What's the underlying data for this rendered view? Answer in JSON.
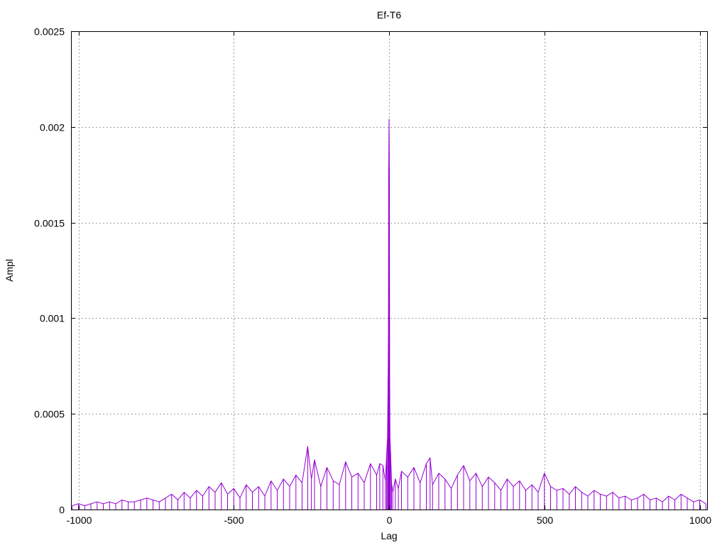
{
  "chart_data": {
    "type": "line",
    "title": "Ef-T6",
    "xlabel": "Lag",
    "ylabel": "Ampl",
    "xlim": [
      -1024,
      1024
    ],
    "ylim": [
      0,
      0.0025
    ],
    "xticks": [
      -1000,
      -500,
      0,
      500,
      1000
    ],
    "xtick_labels": [
      "-1000",
      "-500",
      "0",
      "500",
      "1000"
    ],
    "yticks": [
      0,
      0.0005,
      0.001,
      0.0015,
      0.002,
      0.0025
    ],
    "ytick_labels": [
      "0",
      "0.0005",
      "0.001",
      "0.0015",
      "0.002",
      "0.0025"
    ],
    "grid": true,
    "series": [
      {
        "color": "#9400d3",
        "x": [
          -1020,
          -1000,
          -980,
          -960,
          -940,
          -920,
          -900,
          -880,
          -860,
          -840,
          -820,
          -800,
          -780,
          -760,
          -740,
          -720,
          -700,
          -680,
          -660,
          -640,
          -620,
          -600,
          -580,
          -560,
          -540,
          -520,
          -500,
          -480,
          -460,
          -440,
          -420,
          -400,
          -380,
          -360,
          -340,
          -320,
          -300,
          -280,
          -262,
          -250,
          -240,
          -220,
          -200,
          -180,
          -160,
          -140,
          -120,
          -100,
          -80,
          -60,
          -40,
          -30,
          -20,
          -12,
          -8,
          -5,
          -3,
          -2,
          -1,
          0,
          1,
          2,
          3,
          5,
          8,
          12,
          20,
          30,
          40,
          60,
          80,
          100,
          120,
          132,
          140,
          160,
          180,
          200,
          220,
          240,
          260,
          280,
          300,
          320,
          340,
          360,
          380,
          400,
          420,
          440,
          460,
          480,
          500,
          520,
          540,
          560,
          580,
          600,
          620,
          640,
          660,
          680,
          700,
          720,
          740,
          760,
          780,
          800,
          820,
          840,
          860,
          880,
          900,
          920,
          940,
          960,
          980,
          1000,
          1020
        ],
        "y": [
          2e-05,
          3e-05,
          2e-05,
          3e-05,
          4e-05,
          3e-05,
          4e-05,
          3e-05,
          5e-05,
          4e-05,
          4e-05,
          5e-05,
          6e-05,
          5e-05,
          4e-05,
          6e-05,
          8e-05,
          5e-05,
          9e-05,
          6e-05,
          0.0001,
          7e-05,
          0.00012,
          9e-05,
          0.00014,
          8e-05,
          0.00011,
          6e-05,
          0.00013,
          9e-05,
          0.00012,
          7e-05,
          0.00015,
          0.0001,
          0.00016,
          0.00012,
          0.00018,
          0.00014,
          0.00033,
          0.00016,
          0.00026,
          0.00012,
          0.00022,
          0.00015,
          0.00013,
          0.00025,
          0.00017,
          0.00019,
          0.00014,
          0.00024,
          0.00018,
          0.00024,
          0.00023,
          0.00015,
          0.00028,
          0.00037,
          0.00068,
          0.00087,
          0.00178,
          0.00204,
          0.00178,
          0.00063,
          0.00037,
          0.00029,
          0.00014,
          9e-05,
          0.00016,
          0.00011,
          0.0002,
          0.00017,
          0.00022,
          0.00014,
          0.00024,
          0.00027,
          0.00013,
          0.00019,
          0.00016,
          0.00011,
          0.00018,
          0.00023,
          0.00015,
          0.00019,
          0.00012,
          0.00017,
          0.00014,
          0.0001,
          0.00016,
          0.00012,
          0.00015,
          0.0001,
          0.00013,
          9e-05,
          0.00019,
          0.00012,
          0.0001,
          0.00011,
          8e-05,
          0.00012,
          9e-05,
          7e-05,
          0.0001,
          8e-05,
          7e-05,
          9e-05,
          6e-05,
          7e-05,
          5e-05,
          6e-05,
          8e-05,
          5e-05,
          6e-05,
          4e-05,
          7e-05,
          5e-05,
          8e-05,
          6e-05,
          4e-05,
          5e-05,
          3e-05
        ]
      }
    ]
  }
}
